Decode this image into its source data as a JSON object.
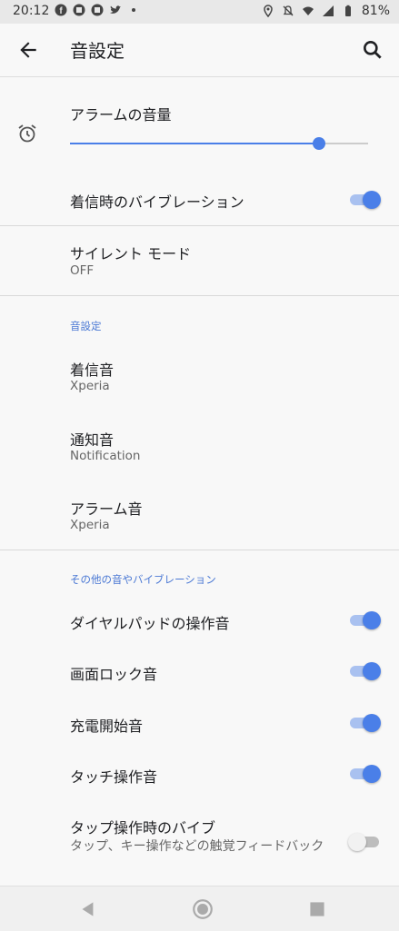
{
  "status_bar": {
    "time": "20:12",
    "battery": "81%",
    "left_icons": [
      "facebook-icon",
      "app-icon",
      "app-icon",
      "twitter-icon",
      "dot-icon"
    ],
    "right_icons": [
      "location-icon",
      "notifications-off-icon",
      "wifi-icon",
      "signal-icon",
      "battery-icon"
    ]
  },
  "toolbar": {
    "title": "音設定",
    "back_icon": "arrow-back-icon",
    "search_icon": "search-icon"
  },
  "alarm_volume": {
    "label": "アラームの音量",
    "icon": "alarm-clock-icon",
    "level": 0.834
  },
  "ring_vibrate": {
    "label": "着信時のバイブレーション",
    "on": true
  },
  "silent_mode": {
    "title": "サイレント モード",
    "value": "OFF"
  },
  "sound_section": {
    "header": "音設定",
    "items": [
      {
        "title": "着信音",
        "value": "Xperia"
      },
      {
        "title": "通知音",
        "value": "Notification"
      },
      {
        "title": "アラーム音",
        "value": "Xperia"
      }
    ]
  },
  "other_section": {
    "header": "その他の音やバイブレーション",
    "items": [
      {
        "title": "ダイヤルパッドの操作音",
        "on": true
      },
      {
        "title": "画面ロック音",
        "on": true
      },
      {
        "title": "充電開始音",
        "on": true
      },
      {
        "title": "タッチ操作音",
        "on": true
      },
      {
        "title": "タップ操作時のバイブ",
        "subtitle": "タップ、キー操作などの触覚フィードバック",
        "on": false
      }
    ]
  },
  "colors": {
    "accent": "#4a7fe8",
    "background": "#f8f8f8"
  }
}
